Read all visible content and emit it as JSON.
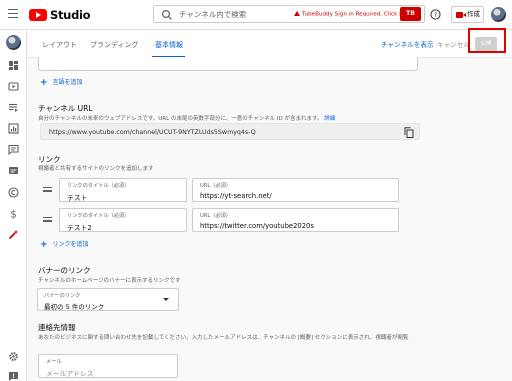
{
  "header": {
    "logo_text": "Studio",
    "search_placeholder": "チャンネル内で検索",
    "tubebuddy_warning": "TubeBuddy Sign in Required. Click Here",
    "create_label": "作成",
    "tubebuddy_button": "TB"
  },
  "tabs": [
    {
      "label": "レイアウト"
    },
    {
      "label": "ブランディング"
    },
    {
      "label": "基本情報"
    }
  ],
  "actions": {
    "view_channel": "チャンネルを表示",
    "cancel": "キャンセル",
    "publish": "公開"
  },
  "add_language_label": "言語を追加",
  "channel_url": {
    "heading": "チャンネル URL",
    "description": "自分のチャンネルの未来のウェブアドレスです。URL の末尾の英数字部分に、一意のチャンネル ID が含まれます。",
    "details_link": "詳細",
    "value": "https://www.youtube.com/channel/UCUT-9NYTZLUds5Swmyq4s-Q"
  },
  "links": {
    "heading": "リンク",
    "description": "視聴者と共有するサイトのリンクを追加します",
    "title_label": "リンクのタイトル（必須）",
    "url_label": "URL（必須）",
    "items": [
      {
        "title": "テスト",
        "url": "https://yt-search.net/"
      },
      {
        "title": "テスト2",
        "url": "https://twitter.com/youtube2020s"
      }
    ],
    "add_label": "リンクを追加"
  },
  "banner_links": {
    "heading": "バナーのリンク",
    "description": "チャンネルのホームページのバナーに表示するリンクです",
    "select_label": "バナーのリンク",
    "select_value": "最初の 5 件のリンク"
  },
  "contact": {
    "heading": "連絡先情報",
    "description": "あなたのビジネスに関する問い合わせ先を記載してください。入力したメールアドレスは、チャンネルの [概要] セクションに表示され、視聴者が閲覧",
    "email_label": "メール",
    "email_placeholder": "メールアドレス"
  },
  "colors": {
    "accent": "#065fd4",
    "brand_red": "#ff0000",
    "highlight_box": "#e00000"
  }
}
